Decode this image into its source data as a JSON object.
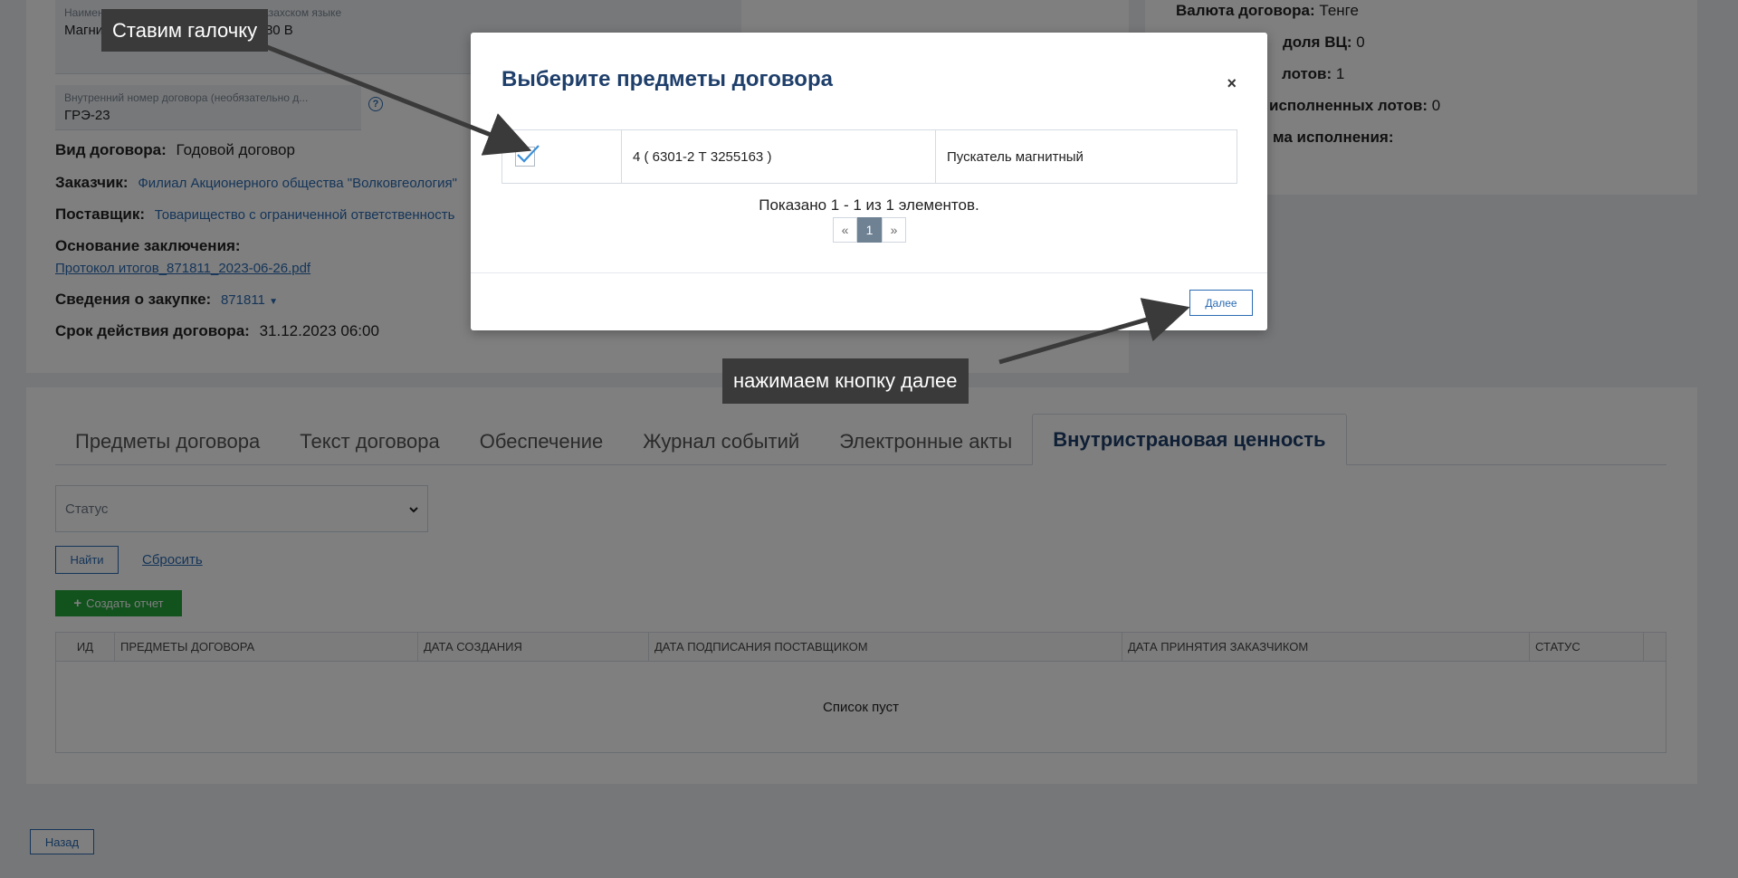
{
  "form": {
    "name_kz_label": "Наименование предмета договора на казахском языке",
    "name_kz_value": "Магнитті іске қосқыш, кернеуі: 380 В",
    "internal_number_label": "Внутренний номер договора (необязательно д...",
    "internal_number_value": "ГРЭ-23",
    "help_glyph": "?",
    "contract_type_label": "Вид договора:",
    "contract_type_value": "Годовой договор",
    "customer_label": "Заказчик:",
    "customer_value": "Филиал Акционерного общества \"Волковгеология\"",
    "supplier_label": "Поставщик:",
    "supplier_value": "Товарищество с ограниченной ответственность",
    "basis_label": "Основание заключения:",
    "basis_link": "Протокол итогов_871811_2023-06-26.pdf",
    "procurement_label": "Сведения о закупке:",
    "procurement_value": "871811",
    "term_label": "Срок действия договора:",
    "term_value": "31.12.2023 06:00"
  },
  "summary": {
    "currency_label": "Валюта договора:",
    "currency_value": "Тенге",
    "vc_label": "доля ВЦ:",
    "vc_value": "0",
    "lots_label": "лотов:",
    "lots_value": "1",
    "done_label": "исполненных лотов:",
    "done_value": "0",
    "sum_label": "ма исполнения:"
  },
  "tabs": [
    {
      "label": "Предметы договора"
    },
    {
      "label": "Текст договора"
    },
    {
      "label": "Обеспечение"
    },
    {
      "label": "Журнал событий"
    },
    {
      "label": "Электронные акты"
    },
    {
      "label": "Внутристрановая ценность"
    }
  ],
  "filter": {
    "status_placeholder": "Статус",
    "find_label": "Найти",
    "reset_label": "Сбросить",
    "create_report_label": "Создать отчет"
  },
  "table": {
    "columns": [
      "ИД",
      "ПРЕДМЕТЫ ДОГОВОРА",
      "ДАТА СОЗДАНИЯ",
      "ДАТА ПОДПИСАНИЯ ПОСТАВЩИКОМ",
      "ДАТА ПРИНЯТИЯ ЗАКАЗЧИКОМ",
      "СТАТУС",
      ""
    ],
    "empty_text": "Список пуст"
  },
  "back_label": "Назад",
  "modal": {
    "title": "Выберите предметы договора",
    "close_glyph": "×",
    "row": {
      "checked": true,
      "code": "4 ( 6301-2 Т 3255163 )",
      "name": "Пускатель магнитный"
    },
    "pager_info": "Показано 1 - 1 из 1 элементов.",
    "pager": {
      "prev": "«",
      "page": "1",
      "next": "»"
    },
    "next_label": "Далее"
  },
  "annotations": {
    "checkbox_hint": "Ставим галочку",
    "next_hint": "нажимаем кнопку далее"
  },
  "colors": {
    "brand_blue": "#2a6bb3",
    "title_navy": "#1f3f6b",
    "report_green": "#22a43b",
    "callout_bg": "#3a3a3a"
  }
}
